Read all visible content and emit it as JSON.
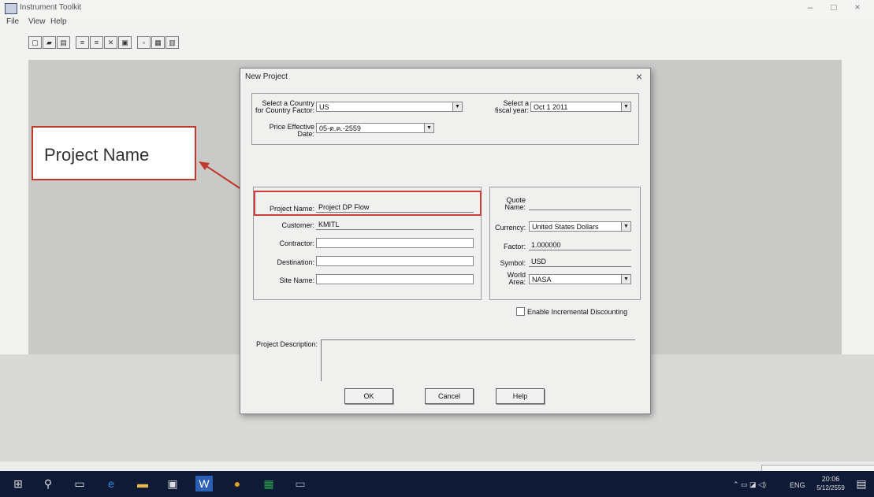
{
  "app": {
    "title": "Instrument Toolkit",
    "menu": [
      "File",
      "View",
      "Help"
    ],
    "window_controls": [
      "–",
      "□",
      "×"
    ]
  },
  "dialog": {
    "title": "New Project",
    "close_glyph": "×",
    "country": {
      "label": "Select a Country for Country Factor:",
      "value": "US"
    },
    "fiscal": {
      "label": "Select a fiscal year:",
      "value": "Oct 1 2011"
    },
    "price_date": {
      "label": "Price Effective Date:",
      "value": "05-ต.ค.-2559"
    },
    "project_name": {
      "label": "Project Name:",
      "value": "Project DP Flow"
    },
    "customer": {
      "label": "Customer:",
      "value": "KMITL"
    },
    "contractor": {
      "label": "Contractor:",
      "value": ""
    },
    "destination": {
      "label": "Destination:",
      "value": ""
    },
    "site_name": {
      "label": "Site Name:",
      "value": ""
    },
    "quote_name": {
      "label": "Quote Name:",
      "value": ""
    },
    "currency": {
      "label": "Currency:",
      "value": "United States Dollars"
    },
    "factor": {
      "label": "Factor:",
      "value": "1.000000"
    },
    "symbol": {
      "label": "Symbol:",
      "value": "USD"
    },
    "world_area": {
      "label": "World Area:",
      "value": "NASA"
    },
    "incremental": {
      "label": "Enable Incremental Discounting",
      "checked": false
    },
    "description": {
      "label": "Project Description:",
      "value": ""
    },
    "buttons": {
      "ok": "OK",
      "cancel": "Cancel",
      "help": "Help"
    }
  },
  "callout": {
    "text": "Project Name",
    "color": "#c0392b"
  },
  "taskbar": {
    "tray": {
      "lang": "ENG",
      "time": "20:06",
      "date": "5/12/2559"
    }
  }
}
